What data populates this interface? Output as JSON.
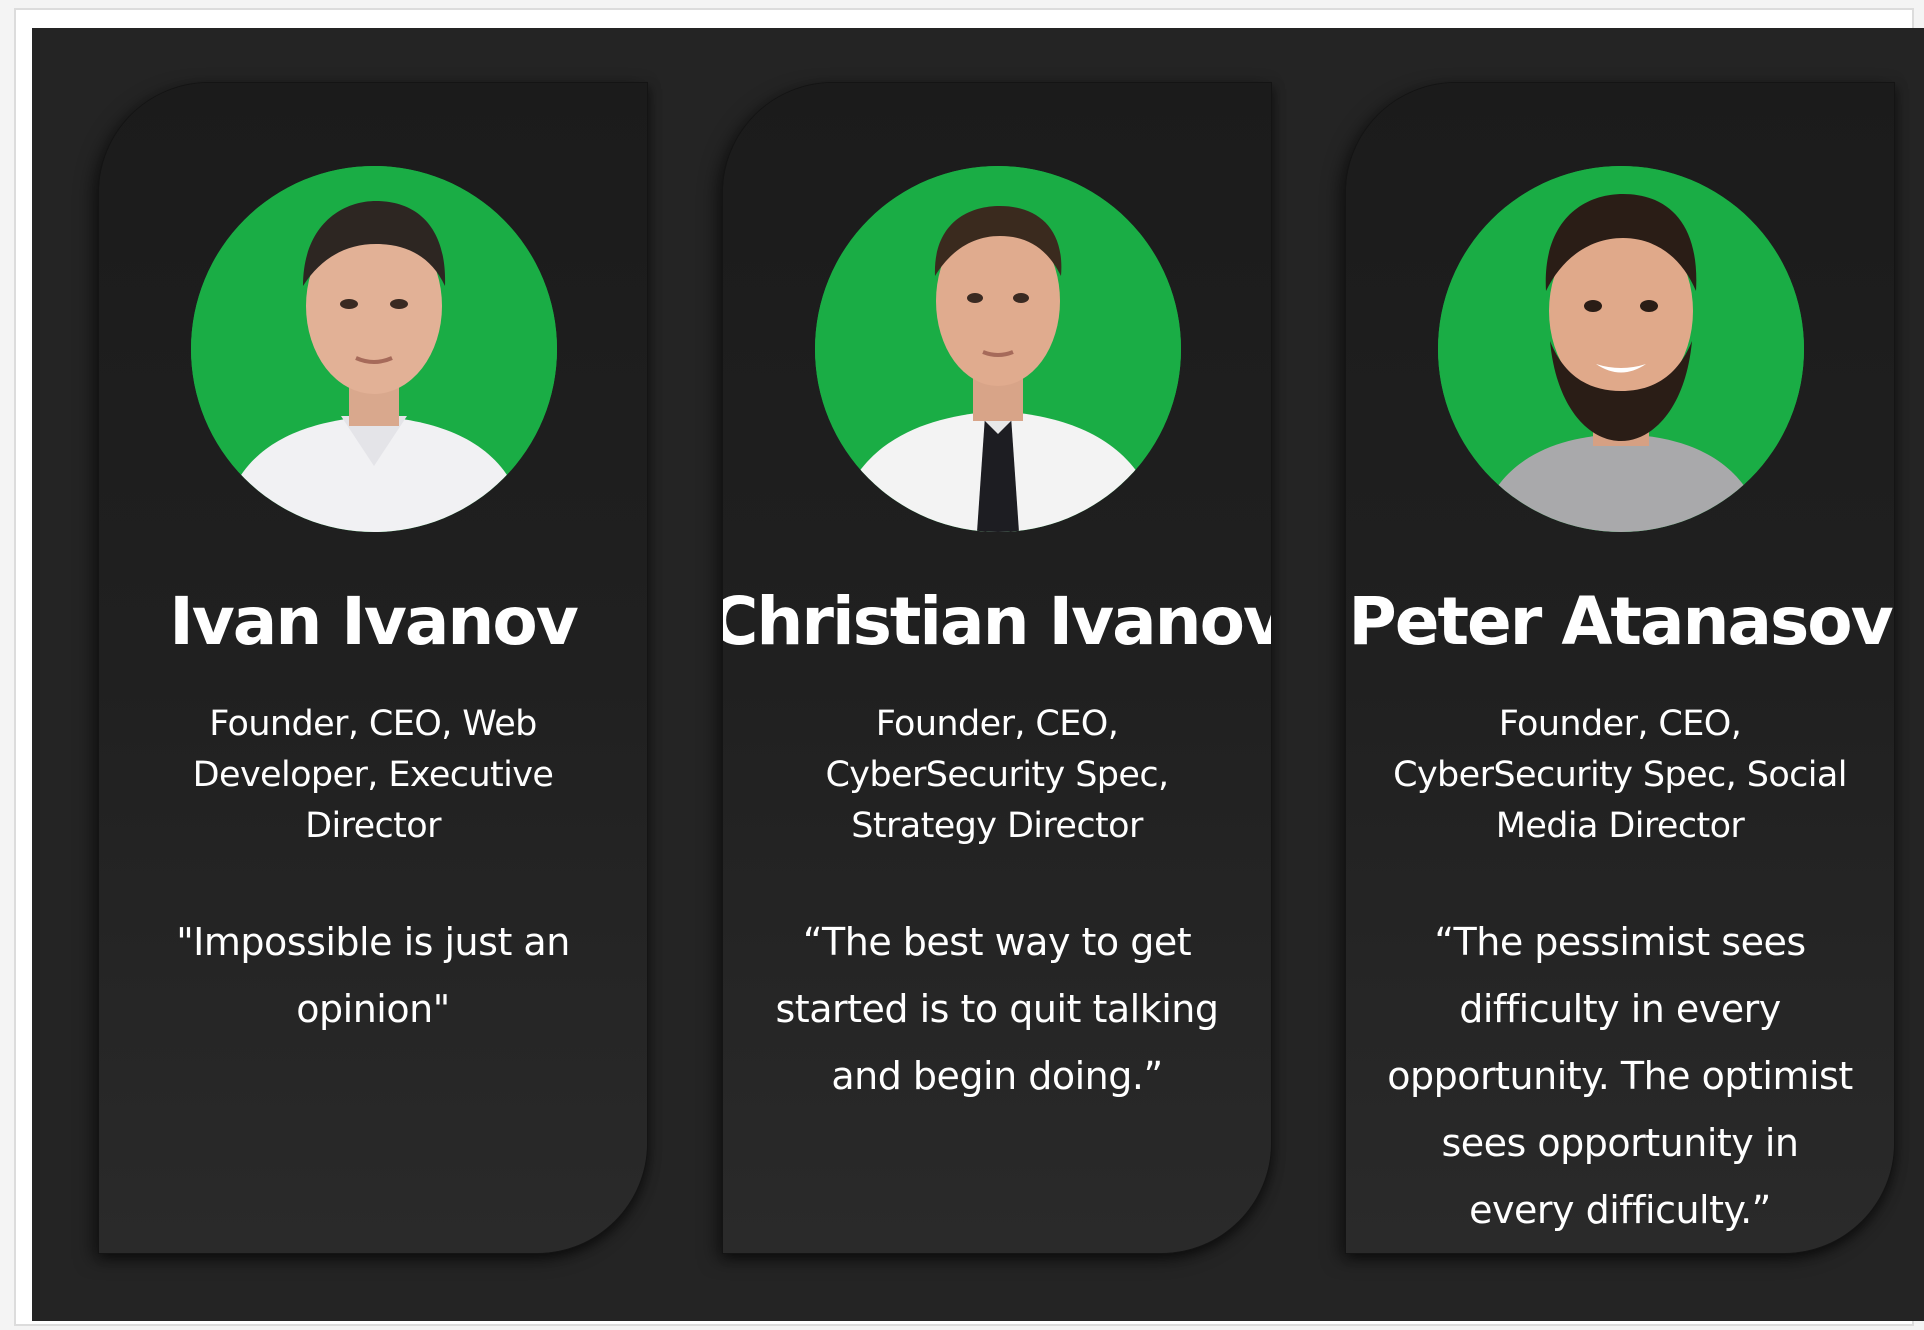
{
  "team": {
    "members": [
      {
        "name": "Ivan Ivanov",
        "role": "Founder, CEO, Web Developer, Executive Director",
        "quote": "\"Impossible is just an opinion\""
      },
      {
        "name": "Christian Ivanov",
        "role": "Founder, CEO, CyberSecurity Spec, Strategy Director",
        "quote": "“The best way to get started is to quit talking and begin doing.”"
      },
      {
        "name": "Peter Atanasov",
        "role": "Founder, CEO, CyberSecurity Spec, Social Media Director",
        "quote": "“The pessimist sees difficulty in every opportunity. The optimist sees opportunity in every difficulty.”"
      }
    ]
  },
  "colors": {
    "background": "#242424",
    "card": "#1e1e1e",
    "avatar_bg": "#1aad45",
    "text": "#ffffff"
  }
}
